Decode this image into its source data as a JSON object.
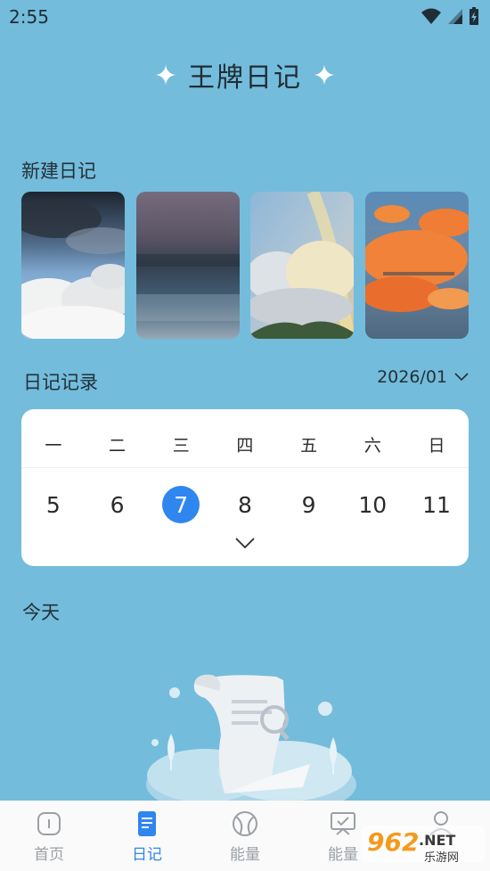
{
  "status_bar": {
    "time": "2:55"
  },
  "header": {
    "title": "王牌日记"
  },
  "new_diary": {
    "label": "新建日记"
  },
  "diary_records": {
    "label": "日记记录",
    "month": "2026/01",
    "weekdays": [
      "一",
      "二",
      "三",
      "四",
      "五",
      "六",
      "日"
    ],
    "days": [
      "5",
      "6",
      "7",
      "8",
      "9",
      "10",
      "11"
    ],
    "selected_day": "7"
  },
  "today": {
    "label": "今天"
  },
  "bottom_nav": {
    "items": [
      {
        "label": "首页",
        "icon": "home-icon"
      },
      {
        "label": "日记",
        "icon": "diary-icon",
        "active": true
      },
      {
        "label": "能量",
        "icon": "ball-icon"
      },
      {
        "label": "能量",
        "icon": "checkin-icon"
      },
      {
        "label": "",
        "icon": "profile-icon"
      }
    ]
  },
  "watermark": {
    "brand": "962",
    "suffix": ".NET",
    "sub": "乐游网"
  },
  "colors": {
    "background": "#74bcdb",
    "accent": "#2f86ef",
    "card": "#ffffff"
  }
}
